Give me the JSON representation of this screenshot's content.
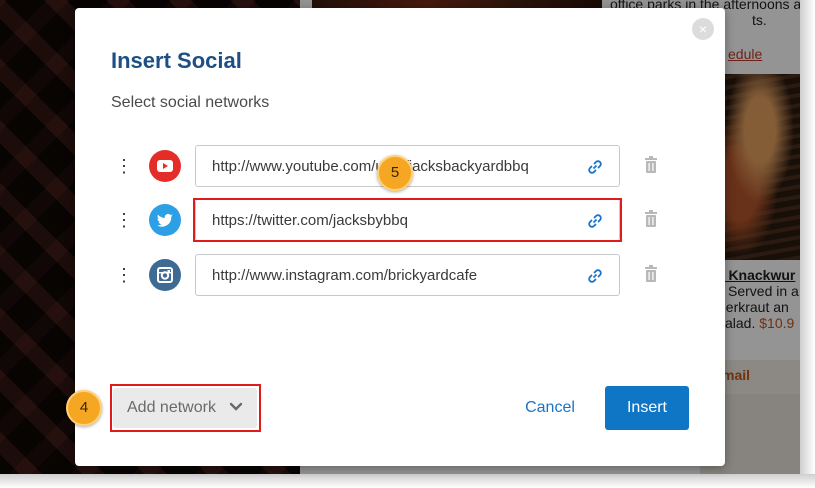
{
  "background": {
    "text_line_1": "office parks in the afternoons a",
    "text_line_2": "ts.",
    "schedule_link": "edule",
    "item_name": "n Knackwur",
    "item_desc_1": "Served in a",
    "item_desc_2": "uerkraut an",
    "item_desc_3": "salad.",
    "item_price": "$10.9",
    "email_link": "mail"
  },
  "modal": {
    "title": "Insert Social",
    "subtitle": "Select social networks",
    "close_glyph": "×",
    "networks": [
      {
        "name": "YouTube",
        "icon": "youtube-icon",
        "color": "#e52d27",
        "url": "http://www.youtube.com/user/jacksbackyardbbq"
      },
      {
        "name": "Twitter",
        "icon": "twitter-icon",
        "color": "#2c9fe5",
        "url": "https://twitter.com/jacksbybbq"
      },
      {
        "name": "Instagram",
        "icon": "instagram-icon",
        "color": "#3e6b94",
        "url": "http://www.instagram.com/brickyardcafe"
      }
    ],
    "add_network_label": "Add network",
    "cancel_label": "Cancel",
    "insert_label": "Insert"
  },
  "callouts": {
    "step_4": "4",
    "step_5": "5"
  },
  "colors": {
    "title": "#1d4f84",
    "primary": "#0f76c6",
    "link": "#1a73c8",
    "highlight": "#e01b1b",
    "callout": "#f5a623"
  }
}
